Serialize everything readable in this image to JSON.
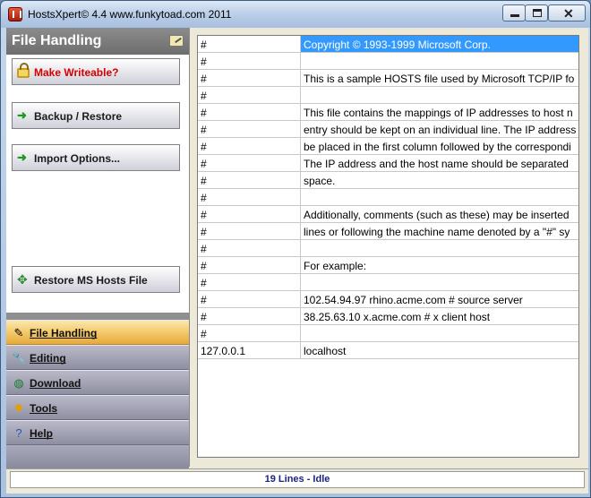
{
  "window": {
    "title": "HostsXpert© 4.4  www.funkytoad.com 2011"
  },
  "sidebar": {
    "header": "File Handling",
    "actions": [
      {
        "label": "Make Writeable?",
        "icon": "lock-icon"
      },
      {
        "label": "Backup / Restore",
        "icon": "green-arrow-icon"
      },
      {
        "label": "Import Options...",
        "icon": "green-arrow-icon"
      },
      {
        "label": "Restore MS Hosts File",
        "icon": "restore-arrows-icon"
      }
    ],
    "nav": [
      {
        "label": "File Handling",
        "icon": "file-edit-icon"
      },
      {
        "label": "Editing",
        "icon": "wrench-icon"
      },
      {
        "label": "Download",
        "icon": "globe-icon"
      },
      {
        "label": "Tools",
        "icon": "sun-tools-icon"
      },
      {
        "label": "Help",
        "icon": "help-icon"
      }
    ]
  },
  "hosts": {
    "rows": [
      {
        "ip": "#",
        "host": "Copyright © 1993-1999 Microsoft Corp."
      },
      {
        "ip": "#",
        "host": ""
      },
      {
        "ip": "#",
        "host": "This is a sample HOSTS file used by Microsoft TCP/IP fo"
      },
      {
        "ip": "#",
        "host": ""
      },
      {
        "ip": "#",
        "host": "This file contains the mappings of IP addresses to host n"
      },
      {
        "ip": "#",
        "host": "entry should be kept on an individual line. The IP address"
      },
      {
        "ip": "#",
        "host": "be placed in the first column followed by the correspondi"
      },
      {
        "ip": "#",
        "host": "The IP address and the host name should be separated"
      },
      {
        "ip": "#",
        "host": "space."
      },
      {
        "ip": "#",
        "host": ""
      },
      {
        "ip": "#",
        "host": "Additionally, comments (such as these) may be inserted"
      },
      {
        "ip": "#",
        "host": "lines or following the machine name denoted by a \"#\" sy"
      },
      {
        "ip": "#",
        "host": ""
      },
      {
        "ip": "#",
        "host": "For example:"
      },
      {
        "ip": "#",
        "host": ""
      },
      {
        "ip": "#",
        "host": "102.54.94.97 rhino.acme.com # source server"
      },
      {
        "ip": "#",
        "host": "38.25.63.10 x.acme.com # x client host"
      },
      {
        "ip": "#",
        "host": ""
      },
      {
        "ip": "127.0.0.1",
        "host": "localhost"
      }
    ],
    "selected_row": 0
  },
  "status": {
    "text": "19 Lines - Idle"
  },
  "colors": {
    "selection": "#3399ff",
    "active_nav": "#f2c664",
    "status_text": "#1a237e",
    "warning_text": "#d50000"
  }
}
